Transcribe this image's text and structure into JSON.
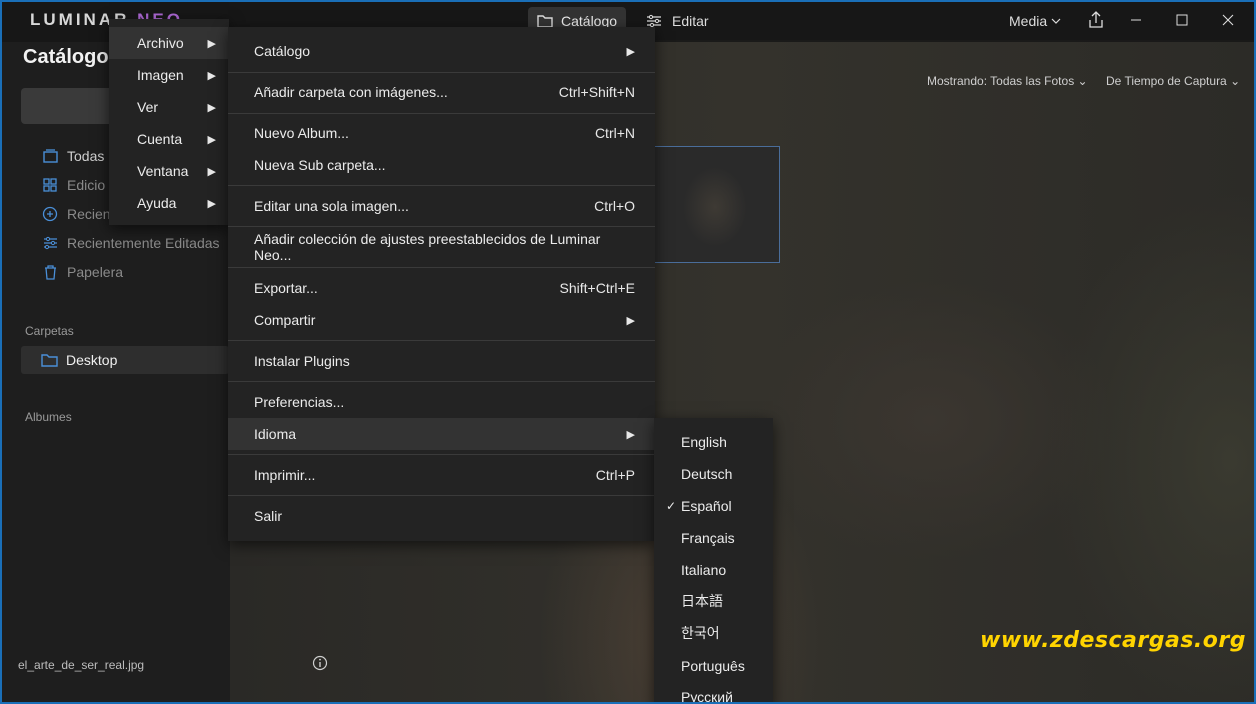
{
  "app": {
    "logo_main": "LUMINAR",
    "logo_suffix": "NEO",
    "tab_catalog": "Catálogo",
    "tab_edit": "Editar",
    "media_label": "Media",
    "accent_blue": "#4a8fd8",
    "accent_purple": "#b06ad8"
  },
  "sidebar": {
    "title": "Catálogo",
    "items": [
      {
        "label": "Todas",
        "icon": "photos-icon"
      },
      {
        "label": "Edicio",
        "icon": "grid-icon"
      },
      {
        "label": "Recien",
        "icon": "plus-circle-icon"
      },
      {
        "label": "Recientemente Editadas",
        "icon": "sliders-icon"
      },
      {
        "label": "Papelera",
        "icon": "trash-icon"
      }
    ],
    "folders_label": "Carpetas",
    "folder_item": "Desktop",
    "albums_label": "Albumes",
    "filename": "el_arte_de_ser_real.jpg"
  },
  "toolbar": {
    "showing": "Mostrando: Todas las Fotos",
    "sort": "De Tiempo de Captura"
  },
  "menu_bar": {
    "items": [
      "Archivo",
      "Imagen",
      "Ver",
      "Cuenta",
      "Ventana",
      "Ayuda"
    ]
  },
  "archivo_menu": {
    "items": [
      {
        "label": "Catálogo",
        "shortcut": "",
        "submenu": true
      },
      {
        "label": "Añadir carpeta con imágenes...",
        "shortcut": "Ctrl+Shift+N"
      },
      {
        "label": "Nuevo Album...",
        "shortcut": "Ctrl+N"
      },
      {
        "label": "Nueva Sub carpeta...",
        "shortcut": ""
      },
      {
        "label": "Editar una sola imagen...",
        "shortcut": "Ctrl+O"
      },
      {
        "label": "Añadir colección de ajustes preestablecidos de Luminar Neo...",
        "shortcut": ""
      },
      {
        "label": "Exportar...",
        "shortcut": "Shift+Ctrl+E"
      },
      {
        "label": "Compartir",
        "shortcut": "",
        "submenu": true
      },
      {
        "label": "Instalar Plugins",
        "shortcut": ""
      },
      {
        "label": "Preferencias...",
        "shortcut": ""
      },
      {
        "label": "Idioma",
        "shortcut": "",
        "submenu": true
      },
      {
        "label": "Imprimir...",
        "shortcut": "Ctrl+P"
      },
      {
        "label": "Salir",
        "shortcut": ""
      }
    ]
  },
  "language_menu": {
    "items": [
      "English",
      "Deutsch",
      "Español",
      "Français",
      "Italiano",
      "日本語",
      "한국어",
      "Português",
      "Русский"
    ],
    "selected": "Español"
  },
  "watermark": "www.zdescargas.org"
}
